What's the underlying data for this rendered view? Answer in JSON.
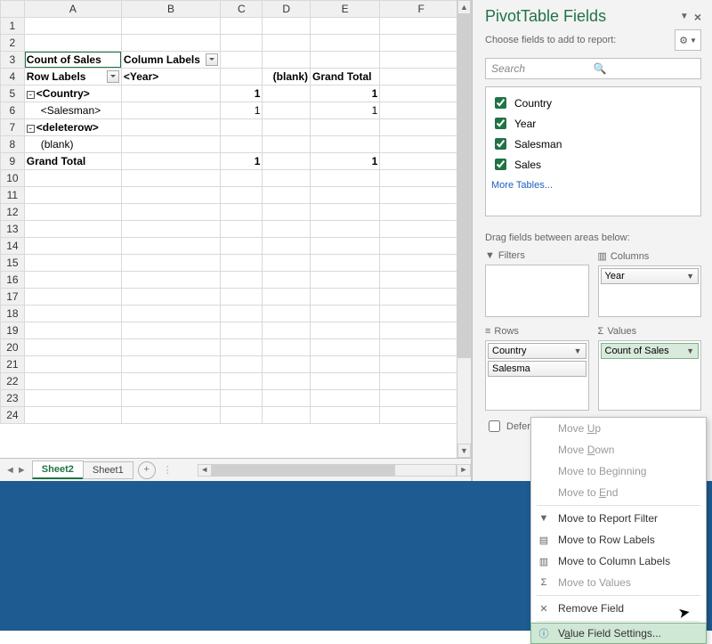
{
  "columns": [
    "A",
    "B",
    "C",
    "D",
    "E",
    "F"
  ],
  "rows": [
    "1",
    "2",
    "3",
    "4",
    "5",
    "6",
    "7",
    "8",
    "9",
    "10",
    "11",
    "12",
    "13",
    "14",
    "15",
    "16",
    "17",
    "18",
    "19",
    "20",
    "21",
    "22",
    "23",
    "24"
  ],
  "pivot": {
    "count_of_sales": "Count of Sales",
    "column_labels": "Column Labels",
    "row_labels": "Row Labels",
    "year_hdr": "<Year>",
    "blank_hdr": "(blank)",
    "grand_total_hdr": "Grand Total",
    "country_row": "<Country>",
    "salesman_row": "<Salesman>",
    "deleterow_row": "<deleterow>",
    "blank_row": "(blank)",
    "grand_total_row": "Grand Total",
    "val_c5": "1",
    "val_e5": "1",
    "val_c6": "1",
    "val_e6": "1",
    "val_c9": "1",
    "val_e9": "1"
  },
  "sheet_tabs": {
    "active": "Sheet2",
    "other": "Sheet1"
  },
  "pane": {
    "title": "PivotTable Fields",
    "choose": "Choose fields to add to report:",
    "search_placeholder": "Search",
    "fields": [
      "Country",
      "Year",
      "Salesman",
      "Sales"
    ],
    "more_tables": "More Tables...",
    "drag_label": "Drag fields between areas below:",
    "filters_hdr": "Filters",
    "columns_hdr": "Columns",
    "rows_hdr": "Rows",
    "values_hdr": "Values",
    "col_item": "Year",
    "rows_item1": "Country",
    "rows_item2": "Salesma",
    "values_item": "Count of Sales",
    "defer": "Defer"
  },
  "menu": {
    "move_up": "Move Up",
    "move_down": "Move Down",
    "move_begin": "Move to Beginning",
    "move_end": "Move to End",
    "report_filter": "Move to Report Filter",
    "row_labels": "Move to Row Labels",
    "col_labels": "Move to Column Labels",
    "to_values": "Move to Values",
    "remove": "Remove Field",
    "vfs": "Value Field Settings..."
  }
}
